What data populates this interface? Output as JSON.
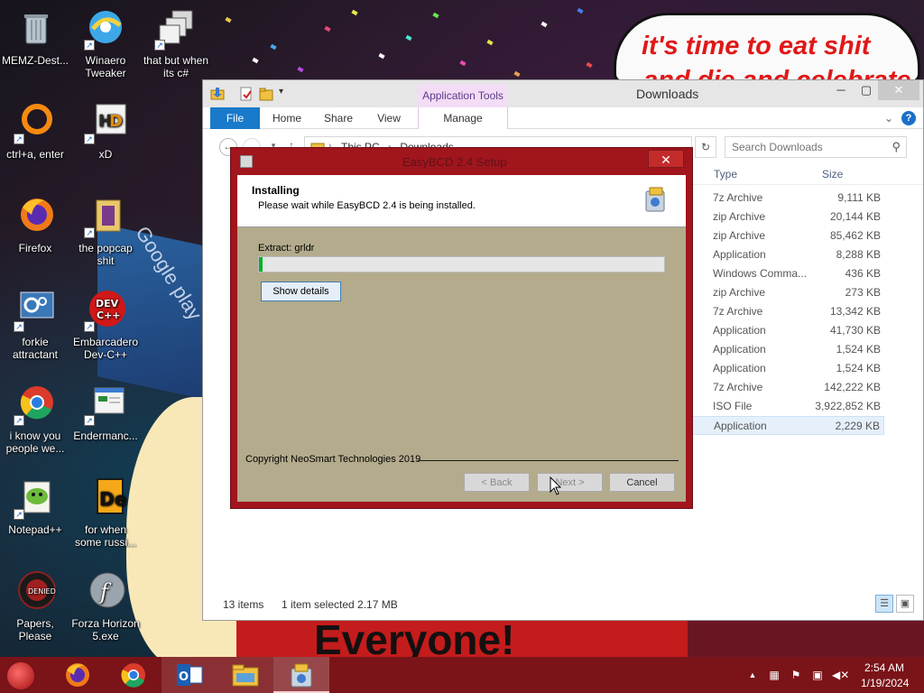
{
  "wallpaper": {
    "speech_line1": "it's time to eat shit",
    "speech_line2": "and die and celebrate",
    "banner_text": "Everyone!",
    "sign_text": "Google play"
  },
  "desktop_icons": [
    {
      "label": "MEMZ-Dest...",
      "icon": "recycle-bin-icon"
    },
    {
      "label": "Winaero Tweaker",
      "icon": "winaero-icon"
    },
    {
      "label": "that but when its c#",
      "icon": "stacked-windows-icon"
    },
    {
      "label": "ctrl+a, enter",
      "icon": "orange-ring-icon"
    },
    {
      "label": "xD",
      "icon": "hxd-icon"
    },
    {
      "label": "Firefox",
      "icon": "firefox-icon"
    },
    {
      "label": "the popcap shit",
      "icon": "folder-icon"
    },
    {
      "label": "forkie attractant",
      "icon": "settings-monitor-icon"
    },
    {
      "label": "Embarcadero Dev-C++",
      "icon": "devcpp-icon"
    },
    {
      "label": "i know you people we...",
      "icon": "chrome-icon"
    },
    {
      "label": "Endermanc...",
      "icon": "window-app-icon"
    },
    {
      "label": "Notepad++",
      "icon": "notepadpp-icon"
    },
    {
      "label": "for when some russi...",
      "icon": "de-icon"
    },
    {
      "label": "Papers, Please",
      "icon": "papers-please-icon"
    },
    {
      "label": "Forza Horizon 5.exe",
      "icon": "flash-icon"
    }
  ],
  "explorer": {
    "title": "Downloads",
    "app_tools_label": "Application Tools",
    "tabs": [
      "File",
      "Home",
      "Share",
      "View",
      "Manage"
    ],
    "address": [
      "This PC",
      "Downloads"
    ],
    "search_placeholder": "Search Downloads",
    "columns": {
      "type": "Type",
      "size": "Size"
    },
    "rows": [
      {
        "type": "7z Archive",
        "size": "9,111 KB"
      },
      {
        "type": "zip Archive",
        "size": "20,144 KB"
      },
      {
        "type": "zip Archive",
        "size": "85,462 KB"
      },
      {
        "type": "Application",
        "size": "8,288 KB"
      },
      {
        "type": "Windows Comma...",
        "size": "436 KB"
      },
      {
        "type": "zip Archive",
        "size": "273 KB"
      },
      {
        "type": "7z Archive",
        "size": "13,342 KB"
      },
      {
        "type": "Application",
        "size": "41,730 KB"
      },
      {
        "type": "Application",
        "size": "1,524 KB"
      },
      {
        "type": "Application",
        "size": "1,524 KB"
      },
      {
        "type": "7z Archive",
        "size": "142,222 KB"
      },
      {
        "type": "ISO File",
        "size": "3,922,852 KB"
      },
      {
        "type": "Application",
        "size": "2,229 KB",
        "selected": true
      }
    ],
    "status_count": "13 items",
    "status_selected": "1 item selected  2.17 MB"
  },
  "installer": {
    "title": "EasyBCD 2.4 Setup",
    "heading": "Installing",
    "subheading": "Please wait while EasyBCD 2.4 is being installed.",
    "extract_label": "Extract: grldr",
    "progress": 0.01,
    "show_details_label": "Show details",
    "copyright": "Copyright NeoSmart Technologies 2019",
    "back_label": "< Back",
    "next_label": "Next >",
    "cancel_label": "Cancel"
  },
  "taskbar": {
    "items": [
      "start-orb-icon",
      "firefox-icon",
      "chrome-icon",
      "outlook-icon",
      "file-explorer-icon",
      "installer-icon"
    ],
    "time": "2:54 AM",
    "date": "1/19/2024"
  },
  "colors": {
    "taskbar": "#7a1418",
    "installer_frame": "#a1151d",
    "installer_body": "#b3ab8c",
    "ribbon_file": "#1979ca",
    "progress": "#06b025",
    "speech_text": "#e01818"
  }
}
